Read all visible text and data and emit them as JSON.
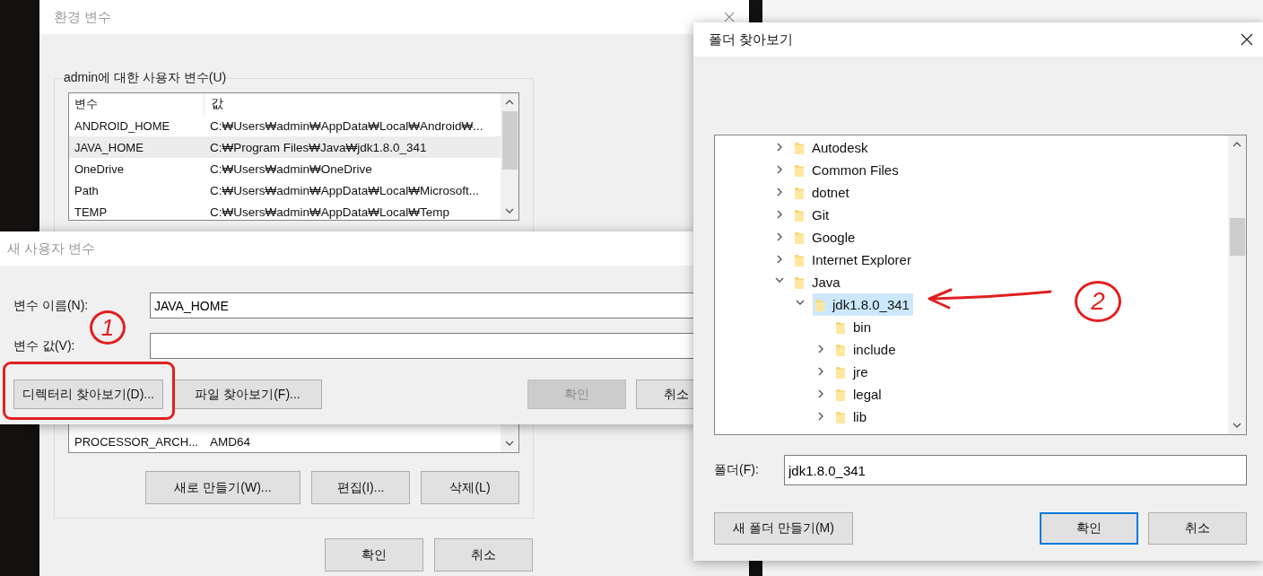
{
  "env_window": {
    "title": "환경 변수",
    "active": false,
    "user_group": {
      "title": "admin에 대한 사용자 변수(U)",
      "columns": [
        "변수",
        "값"
      ],
      "rows": [
        {
          "name": "ANDROID_HOME",
          "value": "C:₩Users₩admin₩AppData₩Local₩Android₩...",
          "selected": false
        },
        {
          "name": "JAVA_HOME",
          "value": "C:₩Program Files₩Java₩jdk1.8.0_341",
          "selected": true
        },
        {
          "name": "OneDrive",
          "value": "C:₩Users₩admin₩OneDrive",
          "selected": false
        },
        {
          "name": "Path",
          "value": "C:₩Users₩admin₩AppData₩Local₩Microsoft...",
          "selected": false
        },
        {
          "name": "TEMP",
          "value": "C:₩Users₩admin₩AppData₩Local₩Temp",
          "selected": false
        }
      ]
    },
    "system_group": {
      "rows": [
        {
          "name": "PROCESSOR_ARCH...",
          "value": "AMD64",
          "selected": false
        }
      ],
      "buttons": [
        "새로 만들기(W)...",
        "편집(I)...",
        "삭제(L)"
      ]
    },
    "buttons": [
      "확인",
      "취소"
    ]
  },
  "new_var_dialog": {
    "title": "새 사용자 변수",
    "active": false,
    "name_label": "변수 이름(N):",
    "name_value": "JAVA_HOME",
    "value_label": "변수 값(V):",
    "browse_dir": "디렉터리 찾아보기(D)...",
    "browse_file": "파일 찾아보기(F)...",
    "buttons": [
      {
        "label": "확인",
        "disabled": true
      },
      {
        "label": "취소",
        "disabled": false
      }
    ]
  },
  "folder_dialog": {
    "title": "폴더 찾아보기",
    "active": true,
    "tree": [
      {
        "name": "Autodesk",
        "expandable": true,
        "expanded": false,
        "selected": false
      },
      {
        "name": "Common Files",
        "expandable": true,
        "expanded": false,
        "selected": false
      },
      {
        "name": "dotnet",
        "expandable": true,
        "expanded": false,
        "selected": false
      },
      {
        "name": "Git",
        "expandable": true,
        "expanded": false,
        "selected": false
      },
      {
        "name": "Google",
        "expandable": true,
        "expanded": false,
        "selected": false
      },
      {
        "name": "Internet Explorer",
        "expandable": true,
        "expanded": false,
        "selected": false
      },
      {
        "name": "Java",
        "expandable": true,
        "expanded": true,
        "selected": false,
        "children": [
          {
            "name": "jdk1.8.0_341",
            "expandable": true,
            "expanded": true,
            "selected": true,
            "children": [
              {
                "name": "bin",
                "expandable": false,
                "expanded": false,
                "selected": false
              },
              {
                "name": "include",
                "expandable": true,
                "expanded": false,
                "selected": false
              },
              {
                "name": "jre",
                "expandable": true,
                "expanded": false,
                "selected": false
              },
              {
                "name": "legal",
                "expandable": true,
                "expanded": false,
                "selected": false
              },
              {
                "name": "lib",
                "expandable": true,
                "expanded": false,
                "selected": false
              }
            ]
          }
        ]
      }
    ],
    "folder_label": "폴더(F):",
    "folder_value": "jdk1.8.0_341",
    "new_folder": "새 폴더 만들기(M)",
    "buttons": [
      {
        "label": "확인",
        "focused": true
      },
      {
        "label": "취소",
        "focused": false
      }
    ]
  },
  "annotations": [
    "1",
    "2"
  ]
}
